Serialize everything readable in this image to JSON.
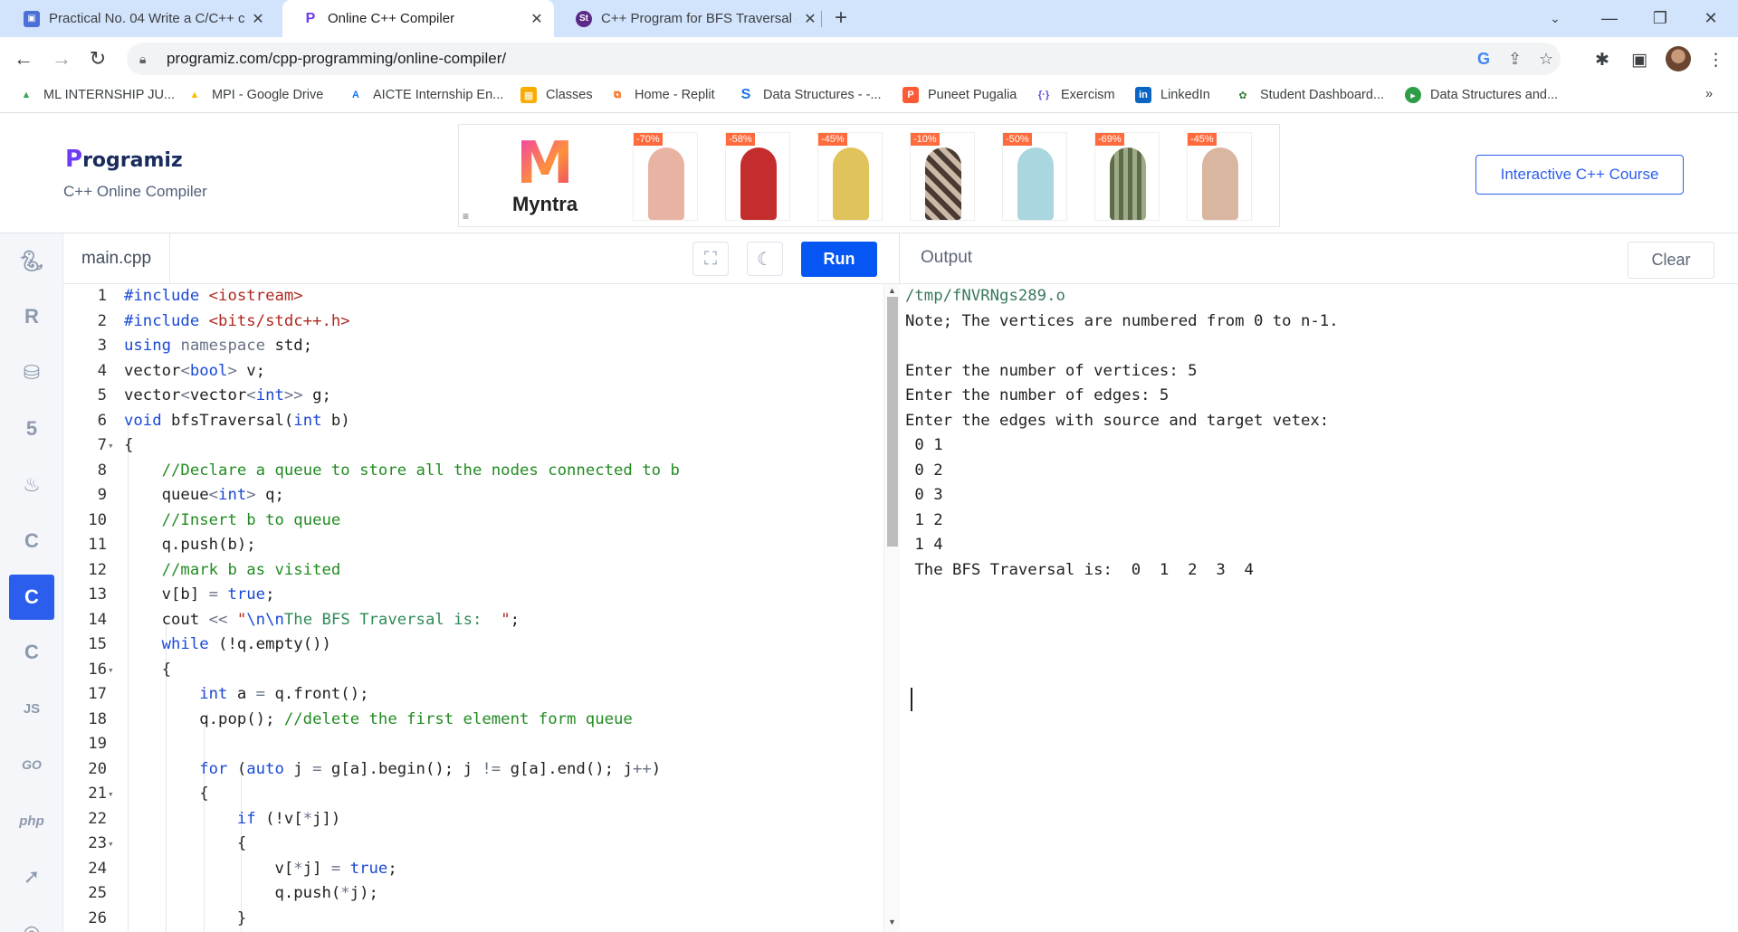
{
  "browser": {
    "tabs": [
      {
        "title": "Practical No. 04 Write a C/C++ c",
        "active": false
      },
      {
        "title": "Online C++ Compiler",
        "active": true
      },
      {
        "title": "C++ Program for BFS Traversal -",
        "active": false
      }
    ],
    "url": "programiz.com/cpp-programming/online-compiler/",
    "bookmarks": [
      "ML INTERNSHIP JU...",
      "MPI - Google Drive",
      "AICTE Internship En...",
      "Classes",
      "Home - Replit",
      "Data Structures - -...",
      "Puneet Pugalia",
      "Exercism",
      "LinkedIn",
      "Student Dashboard...",
      "Data Structures and..."
    ]
  },
  "header": {
    "logo": "rogramiz",
    "logo_initial": "P",
    "subtitle": "C++ Online Compiler",
    "course_button": "Interactive C++ Course",
    "ad": {
      "brand": "Myntra",
      "discounts": [
        "-70%",
        "-58%",
        "-45%",
        "-10%",
        "-50%",
        "-69%",
        "-45%"
      ]
    }
  },
  "languages": [
    "python",
    "r",
    "sql",
    "html",
    "java",
    "c",
    "cpp",
    "csharp",
    "JS",
    "GO",
    "php",
    "swift"
  ],
  "editor": {
    "file_name": "main.cpp",
    "run_label": "Run",
    "lines": [
      {
        "n": "1",
        "fold": "",
        "code": "<span class=\"mac\">#include</span> <span class=\"str\">&lt;iostream&gt;</span>"
      },
      {
        "n": "2",
        "fold": "",
        "code": "<span class=\"mac\">#include</span> <span class=\"str\">&lt;bits/stdc++.h&gt;</span>"
      },
      {
        "n": "3",
        "fold": "",
        "code": "<span class=\"kw\">using</span> <span class=\"op\">namespace</span> std;"
      },
      {
        "n": "4",
        "fold": "",
        "code": "vector<span class=\"op\">&lt;</span><span class=\"kw\">bool</span><span class=\"op\">&gt;</span> v;"
      },
      {
        "n": "5",
        "fold": "",
        "code": "vector<span class=\"op\">&lt;</span>vector<span class=\"op\">&lt;</span><span class=\"kw\">int</span><span class=\"op\">&gt;&gt;</span> g;"
      },
      {
        "n": "6",
        "fold": "",
        "code": "<span class=\"kw\">void</span> bfsTraversal(<span class=\"kw\">int</span> b)"
      },
      {
        "n": "7",
        "fold": "▾",
        "code": "{"
      },
      {
        "n": "8",
        "fold": "",
        "code": "    <span class=\"cmt\">//Declare a queue to store all the nodes connected to b</span>"
      },
      {
        "n": "9",
        "fold": "",
        "code": "    queue<span class=\"op\">&lt;</span><span class=\"kw\">int</span><span class=\"op\">&gt;</span> q;"
      },
      {
        "n": "10",
        "fold": "",
        "code": "    <span class=\"cmt\">//Insert b to queue</span>"
      },
      {
        "n": "11",
        "fold": "",
        "code": "    q.push(b);"
      },
      {
        "n": "12",
        "fold": "",
        "code": "    <span class=\"cmt\">//mark b as visited</span>"
      },
      {
        "n": "13",
        "fold": "",
        "code": "    v[b] <span class=\"op\">=</span> <span class=\"kw\">true</span>;"
      },
      {
        "n": "14",
        "fold": "",
        "code": "    cout <span class=\"op\">&lt;&lt;</span> <span class=\"str\">\"</span><span class=\"kw\">\\n\\n</span><span class=\"cmt2\">The BFS Traversal is:  </span><span class=\"str\">\"</span>;"
      },
      {
        "n": "15",
        "fold": "",
        "code": "    <span class=\"kw\">while</span> (!q.empty())"
      },
      {
        "n": "16",
        "fold": "▾",
        "code": "    {"
      },
      {
        "n": "17",
        "fold": "",
        "code": "        <span class=\"kw\">int</span> a <span class=\"op\">=</span> q.front();"
      },
      {
        "n": "18",
        "fold": "",
        "code": "        q.pop(); <span class=\"cmt\">//delete the first element form queue</span>"
      },
      {
        "n": "19",
        "fold": "",
        "code": ""
      },
      {
        "n": "20",
        "fold": "",
        "code": "        <span class=\"kw\">for</span> (<span class=\"kw\">auto</span> j <span class=\"op\">=</span> g[a].begin(); j <span class=\"op\">!=</span> g[a].end(); j<span class=\"op\">++</span>)"
      },
      {
        "n": "21",
        "fold": "▾",
        "code": "        {"
      },
      {
        "n": "22",
        "fold": "",
        "code": "            <span class=\"kw\">if</span> (!v[<span class=\"op\">*</span>j])"
      },
      {
        "n": "23",
        "fold": "▾",
        "code": "            {"
      },
      {
        "n": "24",
        "fold": "",
        "code": "                v[<span class=\"op\">*</span>j] <span class=\"op\">=</span> <span class=\"kw\">true</span>;"
      },
      {
        "n": "25",
        "fold": "",
        "code": "                q.push(<span class=\"op\">*</span>j);"
      },
      {
        "n": "26",
        "fold": "",
        "code": "            }"
      }
    ]
  },
  "output": {
    "title": "Output",
    "clear_label": "Clear",
    "lines": [
      "/tmp/fNVRNgs289.o",
      "Note; The vertices are numbered from 0 to n-1.",
      "",
      "Enter the number of vertices: 5",
      "Enter the number of edges: 5",
      "Enter the edges with source and target vetex:",
      " 0 1",
      " 0 2",
      " 0 3",
      " 1 2",
      " 1 4",
      " The BFS Traversal is:  0  1  2  3  4"
    ]
  },
  "colors": {
    "run_button": "#0556f3",
    "active_language": "#2b5eed",
    "keyword": "#1a49d6",
    "string": "#b1281f",
    "comment": "#228b22"
  }
}
